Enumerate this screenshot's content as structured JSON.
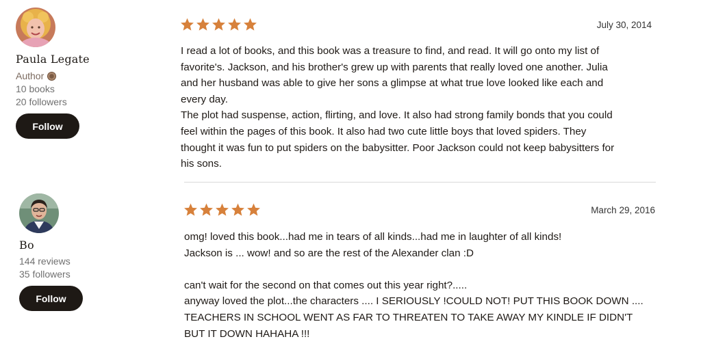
{
  "reviews": [
    {
      "reviewer": {
        "name": "Paula Legate",
        "role": "Author",
        "stat_1": "10 books",
        "stat_2": "20 followers",
        "follow_label": "Follow"
      },
      "rating": 5,
      "date": "July 30, 2014",
      "text": "I read a lot of books, and this book was a treasure to find, and read. It will go onto my list of\nfavorite's. Jackson, and his brother's grew up with parents that really loved one another. Julia\nand her husband was able to give her sons a glimpse at what true love looked like each and\nevery day.\nThe plot had suspense, action, flirting, and love. It also had strong family bonds that you could\nfeel within the pages of this book. It also had two cute little boys that loved spiders. They\nthought it was fun to put spiders on the babysitter. Poor Jackson could not keep babysitters for\nhis sons."
    },
    {
      "reviewer": {
        "name": "Bo",
        "stat_1": "144 reviews",
        "stat_2": "35 followers",
        "follow_label": "Follow"
      },
      "rating": 5,
      "date": "March 29, 2016",
      "text": "omg! loved this book...had me in tears of all kinds...had me in laughter of all kinds!\nJackson is ... wow! and so are the rest of the Alexander clan :D\n\ncan't wait for the second on that comes out this year right?.....\nanyway loved the plot...the characters .... I SERIOUSLY !COULD NOT! PUT THIS BOOK DOWN ....\nTEACHERS IN SCHOOL WENT AS FAR TO THREATEN TO TAKE AWAY MY KINDLE IF DIDN'T\nBUT IT DOWN HAHAHA !!!"
    }
  ],
  "colors": {
    "star": "#d7813b",
    "button_bg": "#1e1915",
    "author_label": "#7b6a5f",
    "divider": "#d8d8d8"
  },
  "icons": {
    "star": "star-icon",
    "author_badge": "author-badge-icon"
  }
}
